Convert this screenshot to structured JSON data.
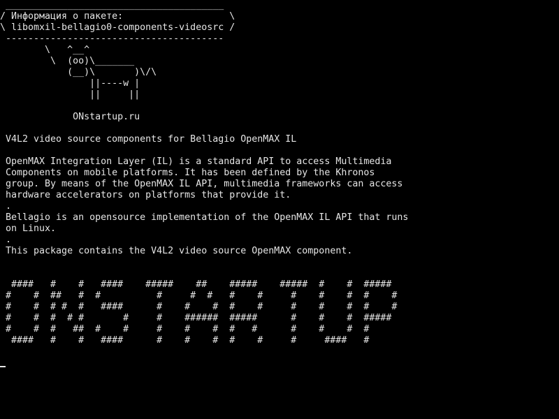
{
  "screen": {
    "background": "#000000",
    "foreground": "#e6e6e6"
  },
  "cowsay": {
    "bubble": " _______________________________________\n/ Информация о пакете:                   \\\n\\ libomxil-bellagio0-components-videosrc /\n ---------------------------------------",
    "cow": "        \\   ^__^\n         \\  (oo)\\_______\n            (__)\\       )\\/\\\n                ||----w |\n                ||     ||",
    "site": "             ONstartup.ru"
  },
  "description": {
    "text": " V4L2 video source components for Bellagio OpenMAX IL\n\n OpenMAX Integration Layer (IL) is a standard API to access Multimedia\n Components on mobile platforms. It has been defined by the Khronos\n group. By means of the OpenMAX IL API, multimedia frameworks can access\n hardware accelerators on platforms that provide it.\n .\n Bellagio is an opensource implementation of the OpenMAX IL API that runs\n on Linux.\n .\n This package contains the V4L2 video source OpenMAX component."
  },
  "banner": {
    "text": "  ####   #    #   ####    #####    ##    #####    #####  #    #  #####\n #    #  ##   #  #          #     #  #   #    #     #    #    #  #    #\n #    #  # #  #   ####      #    #    #  #    #     #    #    #  #    #\n #    #  #  # #       #     #    ######  #####      #    #    #  #####\n #    #  #   ##  #    #     #    #    #  #   #      #    #    #  #\n  ####   #    #   ####      #    #    #  #    #     #     ####   #"
  }
}
